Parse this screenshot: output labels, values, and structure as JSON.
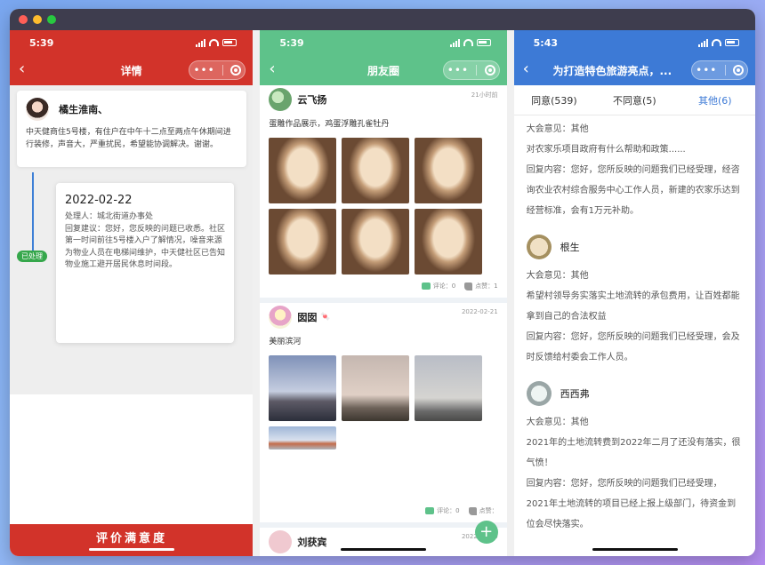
{
  "window": {
    "dot_colors": [
      "#ff5f57",
      "#febc2e",
      "#28c840"
    ]
  },
  "phone1": {
    "time": "5:39",
    "title": "详情",
    "user": {
      "name": "橘生淮南、",
      "text": "中天健商住5号楼，有住户在中午十二点至两点午休期间进行装修，声音大，严重扰民，希望能协调解决。谢谢。"
    },
    "status_tag": "已处理",
    "reply": {
      "date": "2022-02-22",
      "handler": "处理人：城北街道办事处",
      "content": "回复建议：您好，您反映的问题已收悉。社区第一时间前往5号楼入户了解情况，噪音来源为物业人员在电梯间维护，中天健社区已告知物业施工避开居民休息时间段。"
    },
    "rate_button": "评价满意度",
    "accent": "#d2332a"
  },
  "phone2": {
    "time": "5:39",
    "title": "朋友圈",
    "posts": [
      {
        "name": "云飞扬",
        "time": "21小时前",
        "text": "蛋雕作品展示，鸡蛋浮雕孔雀牡丹",
        "comments": "评论：0",
        "likes": "点赞：1"
      },
      {
        "name": "囡囡",
        "emoji": "🍬",
        "time": "2022-02-21",
        "text": "美丽滨河",
        "comments": "评论：0",
        "likes": "点赞："
      },
      {
        "name": "刘获宾",
        "time": "2022-02-20"
      }
    ],
    "fab": "+",
    "accent": "#5ec28a"
  },
  "phone3": {
    "time": "5:43",
    "title": "为打造特色旅游亮点，...",
    "tabs": [
      "同意(539)",
      "不同意(5)",
      "其他(6)"
    ],
    "top_item": {
      "opinion": "大会意见：其他",
      "text": "对农家乐项目政府有什么帮助和政策......",
      "reply": "回复内容：您好，您所反映的问题我们已经受理，经咨询农业农村综合服务中心工作人员，新建的农家乐达到经营标准，会有1万元补助。"
    },
    "items": [
      {
        "name": "根生",
        "opinion": "大会意见：其他",
        "text": "希望村领导务实落实土地流转的承包费用，让百姓都能拿到自己的合法权益",
        "reply": "回复内容：您好，您所反映的问题我们已经受理，会及时反馈给村委会工作人员。"
      },
      {
        "name": "西西弗",
        "opinion": "大会意见：其他",
        "text": "2021年的土地流转费到2022年二月了还没有落实，很气愤！",
        "reply": "回复内容：您好，您所反映的问题我们已经受理，2021年土地流转的项目已经上报上级部门，待资金到位会尽快落实。"
      }
    ],
    "accent": "#3d7ad6"
  }
}
